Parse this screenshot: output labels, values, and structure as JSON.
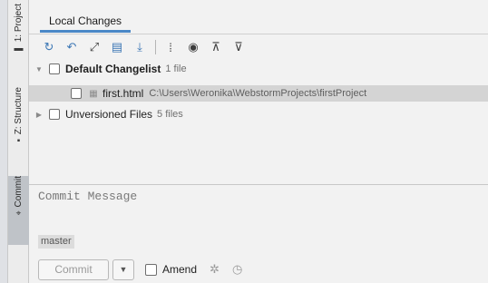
{
  "side_tabs": [
    {
      "label": "1: Project",
      "icon": "folder-icon"
    },
    {
      "label": "Z: Structure",
      "icon": "structure-icon"
    },
    {
      "label": "Commit",
      "icon": "commit-icon"
    }
  ],
  "tabs": {
    "local_changes": "Local Changes"
  },
  "toolbar_icons": [
    "refresh-icon",
    "rollback-icon",
    "show-diff-icon",
    "shelve-icon",
    "update-icon",
    "group-by-icon",
    "preview-icon",
    "expand-all-icon",
    "collapse-all-icon"
  ],
  "tree": {
    "default_changelist": {
      "name": "Default Changelist",
      "count": "1 file"
    },
    "file": {
      "name": "first.html",
      "path": "C:\\Users\\Weronika\\WebstormProjects\\firstProject"
    },
    "unversioned": {
      "name": "Unversioned Files",
      "count": "5 files"
    }
  },
  "commit": {
    "message_placeholder": "Commit Message",
    "branch": "master",
    "commit_label": "Commit",
    "amend_label": "Amend"
  },
  "colors": {
    "accent": "#4a88c7",
    "selected_row": "#d4d4d4",
    "active_side_tab": "#bfc3c8"
  }
}
